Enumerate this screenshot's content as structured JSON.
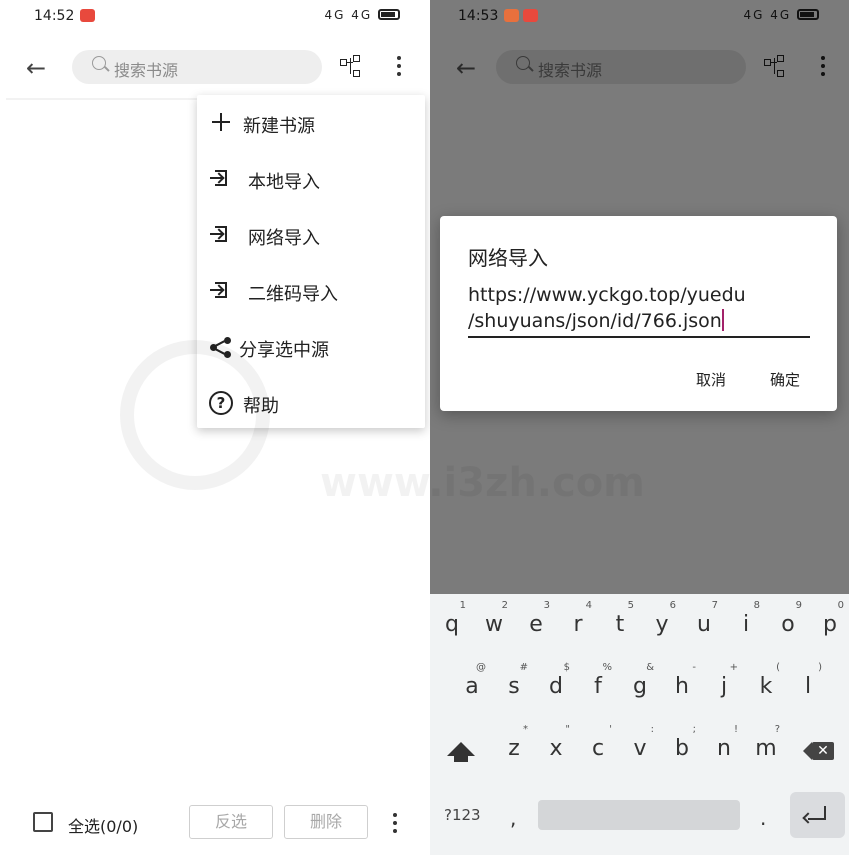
{
  "left": {
    "status": {
      "time": "14:52",
      "signal_text": "4G 4G"
    },
    "search": {
      "placeholder": "搜索书源"
    },
    "menu": [
      {
        "label": "新建书源",
        "icon": "plus-icon"
      },
      {
        "label": "本地导入",
        "icon": "import-icon"
      },
      {
        "label": "网络导入",
        "icon": "import-icon"
      },
      {
        "label": "二维码导入",
        "icon": "import-icon"
      },
      {
        "label": "分享选中源",
        "icon": "share-icon"
      },
      {
        "label": "帮助",
        "icon": "help-icon"
      }
    ],
    "bottom": {
      "select_all": "全选(0/0)",
      "invert": "反选",
      "delete": "删除"
    }
  },
  "watermark": {
    "url": "www.i3zh.com"
  },
  "right": {
    "status": {
      "time": "14:53",
      "signal_text": "4G 4G"
    },
    "search": {
      "placeholder": "搜索书源"
    },
    "dialog": {
      "title": "网络导入",
      "value_line1": "https://www.yckgo.top/yuedu",
      "value_line2": "/shuyuans/json/id/766.json",
      "cancel": "取消",
      "confirm": "确定"
    },
    "keyboard": {
      "row1": [
        {
          "c": "q",
          "h": "1"
        },
        {
          "c": "w",
          "h": "2"
        },
        {
          "c": "e",
          "h": "3"
        },
        {
          "c": "r",
          "h": "4"
        },
        {
          "c": "t",
          "h": "5"
        },
        {
          "c": "y",
          "h": "6"
        },
        {
          "c": "u",
          "h": "7"
        },
        {
          "c": "i",
          "h": "8"
        },
        {
          "c": "o",
          "h": "9"
        },
        {
          "c": "p",
          "h": "0"
        }
      ],
      "row2": [
        {
          "c": "a",
          "h": "@"
        },
        {
          "c": "s",
          "h": "#"
        },
        {
          "c": "d",
          "h": "$"
        },
        {
          "c": "f",
          "h": "%"
        },
        {
          "c": "g",
          "h": "&"
        },
        {
          "c": "h",
          "h": "-"
        },
        {
          "c": "j",
          "h": "+"
        },
        {
          "c": "k",
          "h": "("
        },
        {
          "c": "l",
          "h": ")"
        }
      ],
      "row3": [
        {
          "c": "z",
          "h": "*"
        },
        {
          "c": "x",
          "h": "\""
        },
        {
          "c": "c",
          "h": "'"
        },
        {
          "c": "v",
          "h": ":"
        },
        {
          "c": "b",
          "h": ";"
        },
        {
          "c": "n",
          "h": "!"
        },
        {
          "c": "m",
          "h": "?"
        }
      ],
      "mode_key": "?123",
      "comma": ",",
      "period": "."
    }
  }
}
